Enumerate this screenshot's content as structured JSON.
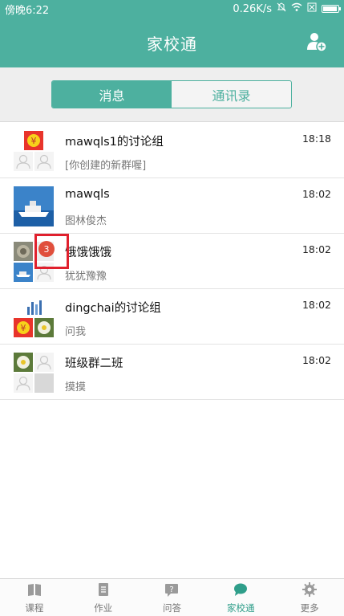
{
  "status": {
    "time": "傍晚6:22",
    "speed": "0.26K/s",
    "icons": [
      "mute-icon",
      "wifi-icon",
      "sim-icon",
      "battery-icon"
    ]
  },
  "header": {
    "title": "家校通",
    "action_icon": "add-user-icon"
  },
  "tabs": [
    {
      "label": "消息",
      "active": true
    },
    {
      "label": "通讯录",
      "active": false
    }
  ],
  "conversations": [
    {
      "name": "mawqls1的讨论组",
      "preview": "[你创建的新群喔]",
      "time": "18:18"
    },
    {
      "name": "mawqls",
      "preview": "图林俊杰",
      "time": "18:02"
    },
    {
      "name": "饿饿饿饿",
      "preview": "犹犹豫豫",
      "time": "18:02",
      "unread": "3"
    },
    {
      "name": "dingchai的讨论组",
      "preview": "问我",
      "time": "18:02"
    },
    {
      "name": "班级群二班",
      "preview": "摸摸",
      "time": "18:02"
    }
  ],
  "bottom_nav": [
    {
      "label": "课程",
      "icon": "book-icon"
    },
    {
      "label": "作业",
      "icon": "document-icon"
    },
    {
      "label": "问答",
      "icon": "question-icon"
    },
    {
      "label": "家校通",
      "icon": "chat-icon",
      "active": true
    },
    {
      "label": "更多",
      "icon": "gear-icon"
    }
  ],
  "colors": {
    "primary": "#4db09f",
    "badge": "#e04f3c",
    "highlight": "#e0202d"
  }
}
